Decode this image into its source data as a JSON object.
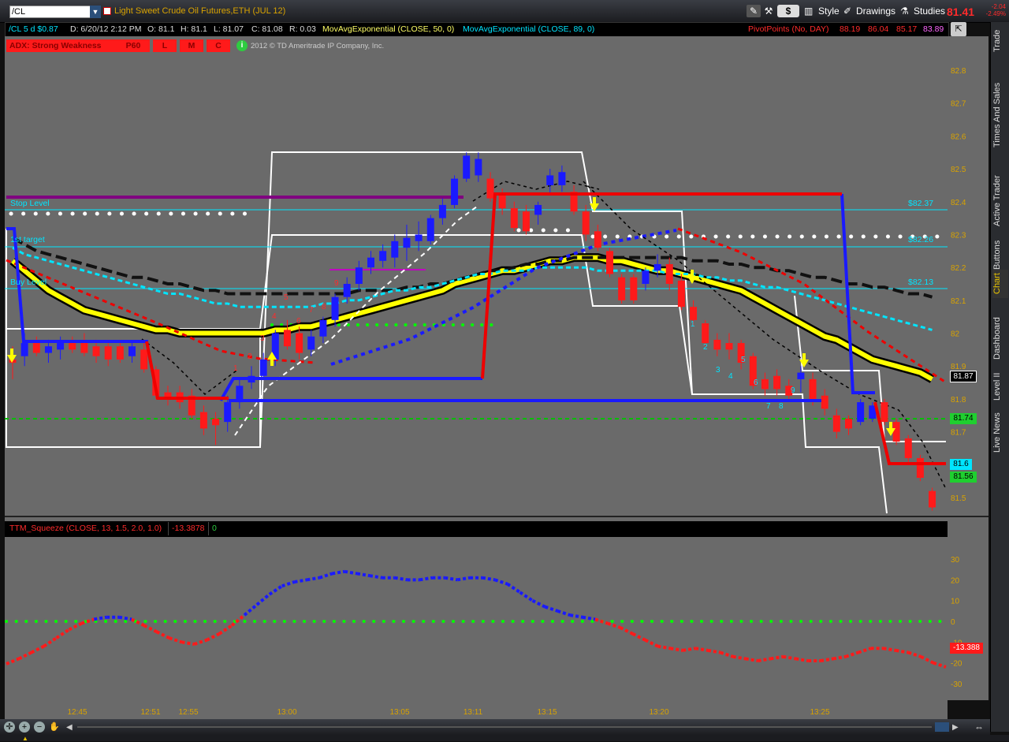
{
  "toolbar": {
    "symbol": "/CL",
    "title": "Light Sweet Crude Oil Futures,ETH (JUL 12)",
    "currency_label": "$",
    "style_label": "Style",
    "drawings_label": "Drawings",
    "studies_label": "Studies",
    "last_price": "81.41",
    "change": "-2.04",
    "change_pct": "-2.49%"
  },
  "info": {
    "aggregation": "/CL 5 d $0.87",
    "date": "D: 6/20/12 2:12 PM",
    "open": "O: 81.1",
    "high": "H: 81.1",
    "low": "L: 81.07",
    "close": "C: 81.08",
    "range": "R: 0.03",
    "ema50": "MovAvgExponential (CLOSE, 50, 0)",
    "ema89": "MovAvgExponential (CLOSE, 89, 0)",
    "pivots": "PivotPoints (No, DAY)",
    "pivot_values": [
      "88.19",
      "86.04",
      "85.17",
      "83.89"
    ]
  },
  "adx": {
    "label": "ADX: Strong Weakness",
    "p60": "P60",
    "l": "L",
    "m": "M",
    "c": "C",
    "copyright": "2012 © TD Ameritrade IP Company, Inc."
  },
  "lower_pane": {
    "study": "TTM_Squeeze (CLOSE, 13, 1.5, 2.0, 1.0)",
    "value": "-13.3878",
    "zero": "0",
    "value_badge": "-13.388"
  },
  "side_tabs": [
    "Trade",
    "Times And Sales",
    "Active Trader",
    "Big Buttons",
    "Chart",
    "Dashboard",
    "Level II",
    "Live News"
  ],
  "levels": {
    "stop_label": "Stop Level",
    "target_label": "1st target",
    "buy_label": "Buy Level",
    "stop_value": "$82.37",
    "target_value": "$82.26",
    "buy_value": "$82.13"
  },
  "price_badges": {
    "close": "81.87",
    "green1": "81.74",
    "cyan": "81.6",
    "green2": "81.56"
  },
  "colors": {
    "bg": "#6a6a6a",
    "up": "#1a1aff",
    "down": "#ff1a1a",
    "ema50": "#111111",
    "ema89": "#00e5ff",
    "yellow_band": "#ffff00",
    "cyan_level": "#00e5ff",
    "green_dots": "#00ff00"
  },
  "chart_data": {
    "type": "candlestick",
    "price_axis": {
      "ticks": [
        82.8,
        82.7,
        82.6,
        82.5,
        82.4,
        82.3,
        82.2,
        82.1,
        82.0,
        81.9,
        81.8,
        81.7,
        81.6,
        81.5
      ],
      "ylim": [
        81.45,
        82.88
      ]
    },
    "time_axis": {
      "ticks": [
        "12:45",
        "12:51",
        "12:55",
        "13:00",
        "13:05",
        "13:11",
        "13:15",
        "13:20",
        "13:25"
      ]
    },
    "candles": [
      {
        "o": 81.92,
        "h": 81.96,
        "l": 81.86,
        "c": 81.91,
        "d": "down"
      },
      {
        "o": 81.93,
        "h": 82.0,
        "l": 81.9,
        "c": 81.97,
        "d": "up"
      },
      {
        "o": 81.97,
        "h": 81.99,
        "l": 81.93,
        "c": 81.94,
        "d": "down"
      },
      {
        "o": 81.94,
        "h": 81.98,
        "l": 81.91,
        "c": 81.96,
        "d": "up"
      },
      {
        "o": 81.95,
        "h": 81.99,
        "l": 81.92,
        "c": 81.97,
        "d": "up"
      },
      {
        "o": 81.97,
        "h": 81.99,
        "l": 81.94,
        "c": 81.95,
        "d": "down"
      },
      {
        "o": 81.97,
        "h": 82.0,
        "l": 81.93,
        "c": 81.94,
        "d": "down"
      },
      {
        "o": 81.96,
        "h": 81.98,
        "l": 81.91,
        "c": 81.93,
        "d": "down"
      },
      {
        "o": 81.96,
        "h": 81.98,
        "l": 81.9,
        "c": 81.92,
        "d": "down"
      },
      {
        "o": 81.96,
        "h": 81.98,
        "l": 81.91,
        "c": 81.92,
        "d": "down"
      },
      {
        "o": 81.93,
        "h": 81.97,
        "l": 81.91,
        "c": 81.96,
        "d": "up"
      },
      {
        "o": 81.95,
        "h": 81.97,
        "l": 81.88,
        "c": 81.89,
        "d": "down"
      },
      {
        "o": 81.89,
        "h": 81.9,
        "l": 81.8,
        "c": 81.81,
        "d": "down"
      },
      {
        "o": 81.82,
        "h": 81.84,
        "l": 81.78,
        "c": 81.8,
        "d": "down"
      },
      {
        "o": 81.82,
        "h": 81.84,
        "l": 81.77,
        "c": 81.79,
        "d": "down"
      },
      {
        "o": 81.81,
        "h": 81.83,
        "l": 81.74,
        "c": 81.75,
        "d": "down"
      },
      {
        "o": 81.76,
        "h": 81.78,
        "l": 81.69,
        "c": 81.71,
        "d": "down"
      },
      {
        "o": 81.74,
        "h": 81.76,
        "l": 81.66,
        "c": 81.72,
        "d": "down"
      },
      {
        "o": 81.73,
        "h": 81.81,
        "l": 81.7,
        "c": 81.79,
        "d": "up"
      },
      {
        "o": 81.79,
        "h": 81.86,
        "l": 81.77,
        "c": 81.84,
        "d": "up"
      },
      {
        "o": 81.85,
        "h": 81.9,
        "l": 81.83,
        "c": 81.87,
        "d": "up"
      },
      {
        "o": 81.87,
        "h": 81.94,
        "l": 81.86,
        "c": 81.92,
        "d": "up"
      },
      {
        "o": 81.92,
        "h": 82.01,
        "l": 81.9,
        "c": 82.0,
        "d": "up"
      },
      {
        "o": 82.01,
        "h": 82.04,
        "l": 81.95,
        "c": 81.96,
        "d": "down"
      },
      {
        "o": 82.0,
        "h": 82.02,
        "l": 81.92,
        "c": 81.94,
        "d": "down"
      },
      {
        "o": 81.95,
        "h": 82.01,
        "l": 81.93,
        "c": 81.99,
        "d": "up"
      },
      {
        "o": 81.99,
        "h": 82.05,
        "l": 81.97,
        "c": 82.04,
        "d": "up"
      },
      {
        "o": 82.04,
        "h": 82.12,
        "l": 82.02,
        "c": 82.11,
        "d": "up"
      },
      {
        "o": 82.11,
        "h": 82.17,
        "l": 82.09,
        "c": 82.15,
        "d": "up"
      },
      {
        "o": 82.15,
        "h": 82.22,
        "l": 82.13,
        "c": 82.2,
        "d": "up"
      },
      {
        "o": 82.2,
        "h": 82.25,
        "l": 82.18,
        "c": 82.23,
        "d": "up"
      },
      {
        "o": 82.22,
        "h": 82.27,
        "l": 82.2,
        "c": 82.25,
        "d": "up"
      },
      {
        "o": 82.23,
        "h": 82.3,
        "l": 82.2,
        "c": 82.28,
        "d": "up"
      },
      {
        "o": 82.26,
        "h": 82.33,
        "l": 82.22,
        "c": 82.29,
        "d": "up"
      },
      {
        "o": 82.28,
        "h": 82.34,
        "l": 82.25,
        "c": 82.3,
        "d": "up"
      },
      {
        "o": 82.28,
        "h": 82.36,
        "l": 82.27,
        "c": 82.35,
        "d": "up"
      },
      {
        "o": 82.35,
        "h": 82.41,
        "l": 82.33,
        "c": 82.39,
        "d": "up"
      },
      {
        "o": 82.39,
        "h": 82.48,
        "l": 82.38,
        "c": 82.47,
        "d": "up"
      },
      {
        "o": 82.47,
        "h": 82.55,
        "l": 82.46,
        "c": 82.54,
        "d": "up"
      },
      {
        "o": 82.48,
        "h": 82.55,
        "l": 82.46,
        "c": 82.53,
        "d": "up"
      },
      {
        "o": 82.47,
        "h": 82.49,
        "l": 82.4,
        "c": 82.41,
        "d": "down"
      },
      {
        "o": 82.42,
        "h": 82.44,
        "l": 82.36,
        "c": 82.38,
        "d": "down"
      },
      {
        "o": 82.38,
        "h": 82.4,
        "l": 82.31,
        "c": 82.32,
        "d": "down"
      },
      {
        "o": 82.37,
        "h": 82.39,
        "l": 82.3,
        "c": 82.31,
        "d": "down"
      },
      {
        "o": 82.36,
        "h": 82.4,
        "l": 82.33,
        "c": 82.39,
        "d": "up"
      },
      {
        "o": 82.45,
        "h": 82.5,
        "l": 82.42,
        "c": 82.48,
        "d": "up"
      },
      {
        "o": 82.45,
        "h": 82.51,
        "l": 82.43,
        "c": 82.49,
        "d": "up"
      },
      {
        "o": 82.43,
        "h": 82.45,
        "l": 82.36,
        "c": 82.37,
        "d": "down"
      },
      {
        "o": 82.37,
        "h": 82.39,
        "l": 82.28,
        "c": 82.3,
        "d": "down"
      },
      {
        "o": 82.31,
        "h": 82.33,
        "l": 82.25,
        "c": 82.26,
        "d": "down"
      },
      {
        "o": 82.25,
        "h": 82.26,
        "l": 82.17,
        "c": 82.18,
        "d": "down"
      },
      {
        "o": 82.17,
        "h": 82.18,
        "l": 82.09,
        "c": 82.1,
        "d": "down"
      },
      {
        "o": 82.17,
        "h": 82.18,
        "l": 82.09,
        "c": 82.1,
        "d": "down"
      },
      {
        "o": 82.15,
        "h": 82.2,
        "l": 82.13,
        "c": 82.19,
        "d": "up"
      },
      {
        "o": 82.19,
        "h": 82.24,
        "l": 82.17,
        "c": 82.21,
        "d": "up"
      },
      {
        "o": 82.21,
        "h": 82.23,
        "l": 82.13,
        "c": 82.15,
        "d": "down"
      },
      {
        "o": 82.16,
        "h": 82.18,
        "l": 82.07,
        "c": 82.08,
        "d": "down"
      },
      {
        "o": 82.08,
        "h": 82.1,
        "l": 82.02,
        "c": 82.04,
        "d": "down"
      },
      {
        "o": 82.03,
        "h": 82.04,
        "l": 81.96,
        "c": 81.97,
        "d": "down"
      },
      {
        "o": 81.98,
        "h": 82.0,
        "l": 81.93,
        "c": 81.95,
        "d": "down"
      },
      {
        "o": 81.97,
        "h": 82.0,
        "l": 81.92,
        "c": 81.95,
        "d": "down"
      },
      {
        "o": 81.97,
        "h": 81.98,
        "l": 81.89,
        "c": 81.91,
        "d": "down"
      },
      {
        "o": 81.93,
        "h": 81.94,
        "l": 81.83,
        "c": 81.84,
        "d": "down"
      },
      {
        "o": 81.86,
        "h": 81.88,
        "l": 81.81,
        "c": 81.83,
        "d": "down"
      },
      {
        "o": 81.87,
        "h": 81.89,
        "l": 81.81,
        "c": 81.83,
        "d": "down"
      },
      {
        "o": 81.84,
        "h": 81.86,
        "l": 81.79,
        "c": 81.81,
        "d": "down"
      },
      {
        "o": 81.86,
        "h": 81.9,
        "l": 81.82,
        "c": 81.88,
        "d": "up"
      },
      {
        "o": 81.86,
        "h": 81.88,
        "l": 81.78,
        "c": 81.8,
        "d": "down"
      },
      {
        "o": 81.81,
        "h": 81.83,
        "l": 81.75,
        "c": 81.77,
        "d": "down"
      },
      {
        "o": 81.75,
        "h": 81.77,
        "l": 81.68,
        "c": 81.7,
        "d": "down"
      },
      {
        "o": 81.74,
        "h": 81.75,
        "l": 81.69,
        "c": 81.71,
        "d": "down"
      },
      {
        "o": 81.73,
        "h": 81.8,
        "l": 81.72,
        "c": 81.79,
        "d": "up"
      },
      {
        "o": 81.74,
        "h": 81.79,
        "l": 81.73,
        "c": 81.78,
        "d": "up"
      },
      {
        "o": 81.79,
        "h": 81.8,
        "l": 81.72,
        "c": 81.73,
        "d": "down"
      },
      {
        "o": 81.73,
        "h": 81.74,
        "l": 81.66,
        "c": 81.67,
        "d": "down"
      },
      {
        "o": 81.68,
        "h": 81.69,
        "l": 81.6,
        "c": 81.62,
        "d": "down"
      },
      {
        "o": 81.62,
        "h": 81.63,
        "l": 81.55,
        "c": 81.56,
        "d": "down"
      },
      {
        "o": 81.52,
        "h": 81.53,
        "l": 81.46,
        "c": 81.47,
        "d": "down"
      }
    ],
    "ema50": [
      82.29,
      82.27,
      82.25,
      82.24,
      82.23,
      82.22,
      82.21,
      82.2,
      82.19,
      82.18,
      82.17,
      82.17,
      82.16,
      82.15,
      82.15,
      82.14,
      82.13,
      82.13,
      82.12,
      82.12,
      82.12,
      82.12,
      82.12,
      82.12,
      82.12,
      82.12,
      82.12,
      82.12,
      82.12,
      82.13,
      82.13,
      82.13,
      82.13,
      82.14,
      82.14,
      82.15,
      82.15,
      82.16,
      82.17,
      82.18,
      82.19,
      82.19,
      82.2,
      82.21,
      82.21,
      82.22,
      82.22,
      82.23,
      82.23,
      82.23,
      82.23,
      82.23,
      82.23,
      82.23,
      82.23,
      82.23,
      82.23,
      82.22,
      82.22,
      82.22,
      82.21,
      82.21,
      82.2,
      82.2,
      82.19,
      82.19,
      82.18,
      82.17,
      82.17,
      82.16,
      82.15,
      82.15,
      82.14,
      82.14,
      82.13,
      82.12,
      82.12,
      82.11
    ],
    "ema89": [
      82.26,
      82.24,
      82.23,
      82.22,
      82.21,
      82.2,
      82.19,
      82.18,
      82.17,
      82.16,
      82.15,
      82.14,
      82.13,
      82.12,
      82.12,
      82.11,
      82.1,
      82.09,
      82.09,
      82.08,
      82.08,
      82.08,
      82.08,
      82.08,
      82.08,
      82.08,
      82.09,
      82.09,
      82.1,
      82.1,
      82.11,
      82.12,
      82.13,
      82.13,
      82.14,
      82.14,
      82.15,
      82.16,
      82.17,
      82.18,
      82.18,
      82.19,
      82.19,
      82.19,
      82.2,
      82.2,
      82.2,
      82.2,
      82.2,
      82.19,
      82.19,
      82.19,
      82.19,
      82.19,
      82.19,
      82.18,
      82.18,
      82.18,
      82.17,
      82.17,
      82.16,
      82.16,
      82.15,
      82.14,
      82.14,
      82.13,
      82.12,
      82.11,
      82.1,
      82.09,
      82.08,
      82.07,
      82.06,
      82.05,
      82.04,
      82.03,
      82.02,
      82.01
    ],
    "yellow_band": [
      82.22,
      82.19,
      82.16,
      82.13,
      82.11,
      82.09,
      82.07,
      82.06,
      82.05,
      82.04,
      82.03,
      82.02,
      82.01,
      82.01,
      82.0,
      82.0,
      82.0,
      82.0,
      82.0,
      82.0,
      82.0,
      82.0,
      82.01,
      82.01,
      82.02,
      82.02,
      82.03,
      82.04,
      82.05,
      82.06,
      82.07,
      82.08,
      82.09,
      82.1,
      82.11,
      82.12,
      82.13,
      82.15,
      82.16,
      82.17,
      82.18,
      82.19,
      82.19,
      82.2,
      82.21,
      82.22,
      82.22,
      82.23,
      82.23,
      82.23,
      82.22,
      82.22,
      82.21,
      82.2,
      82.19,
      82.19,
      82.18,
      82.17,
      82.16,
      82.15,
      82.14,
      82.13,
      82.11,
      82.09,
      82.07,
      82.05,
      82.03,
      82.01,
      81.99,
      81.98,
      81.96,
      81.94,
      81.92,
      81.91,
      81.9,
      81.89,
      81.88,
      81.86
    ],
    "ttm_squeeze": {
      "ticks": [
        30,
        20,
        10,
        0,
        -10,
        -20,
        -30
      ],
      "ylim": [
        -36,
        34
      ],
      "momentum": [
        -20.5,
        -18,
        -15,
        -12,
        -8,
        -4,
        -1,
        1,
        2,
        2,
        1,
        -2,
        -5,
        -8,
        -10,
        -11,
        -9,
        -6,
        -2,
        3,
        8,
        13,
        17,
        19,
        20,
        21,
        23,
        24,
        23,
        22,
        21,
        21,
        20,
        20,
        21,
        21,
        20,
        21,
        21,
        20,
        18,
        14,
        10,
        7,
        5,
        3,
        2,
        1,
        -1,
        -3,
        -6,
        -9,
        -12,
        -13,
        -14,
        -13,
        -14,
        -15,
        -17,
        -18,
        -19,
        -18,
        -17,
        -18,
        -19,
        -19,
        -18,
        -17,
        -15,
        -13,
        -13,
        -14,
        -15,
        -17,
        -20,
        -22
      ]
    },
    "levels": {
      "stop": 82.37,
      "target": 82.26,
      "buy": 82.13,
      "support": 81.74,
      "purple_stop": 82.39
    }
  }
}
